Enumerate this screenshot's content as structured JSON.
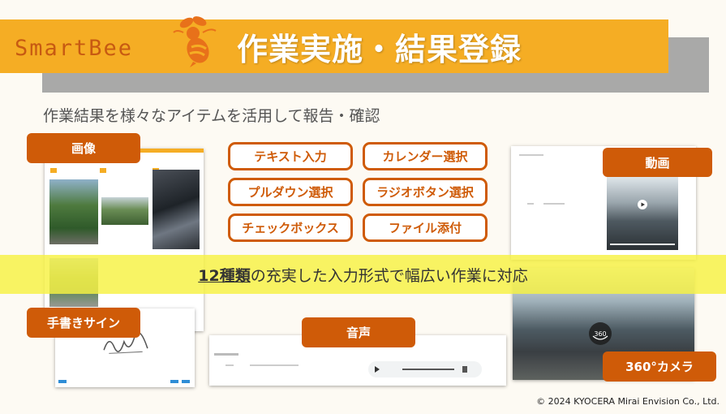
{
  "header": {
    "logo": "SmartBee",
    "title": "作業実施・結果登録"
  },
  "subtitle": "作業結果を様々なアイテムを活用して報告・確認",
  "labels": {
    "image": "画像",
    "video": "動画",
    "handwriting": "手書きサイン",
    "audio": "音声",
    "camera360": "360°カメラ"
  },
  "features": [
    "テキスト入力",
    "カレンダー選択",
    "プルダウン選択",
    "ラジオボタン選択",
    "チェックボックス",
    "ファイル添付"
  ],
  "band": {
    "number": "12種類",
    "rest": "の充実した入力形式で幅広い作業に対応"
  },
  "copyright": "© 2024 KYOCERA Mirai Envision Co., Ltd.",
  "colors": {
    "accent_orange": "#cf5b08",
    "banner_orange": "#f5ad24",
    "band_yellow": "#f7f142"
  }
}
